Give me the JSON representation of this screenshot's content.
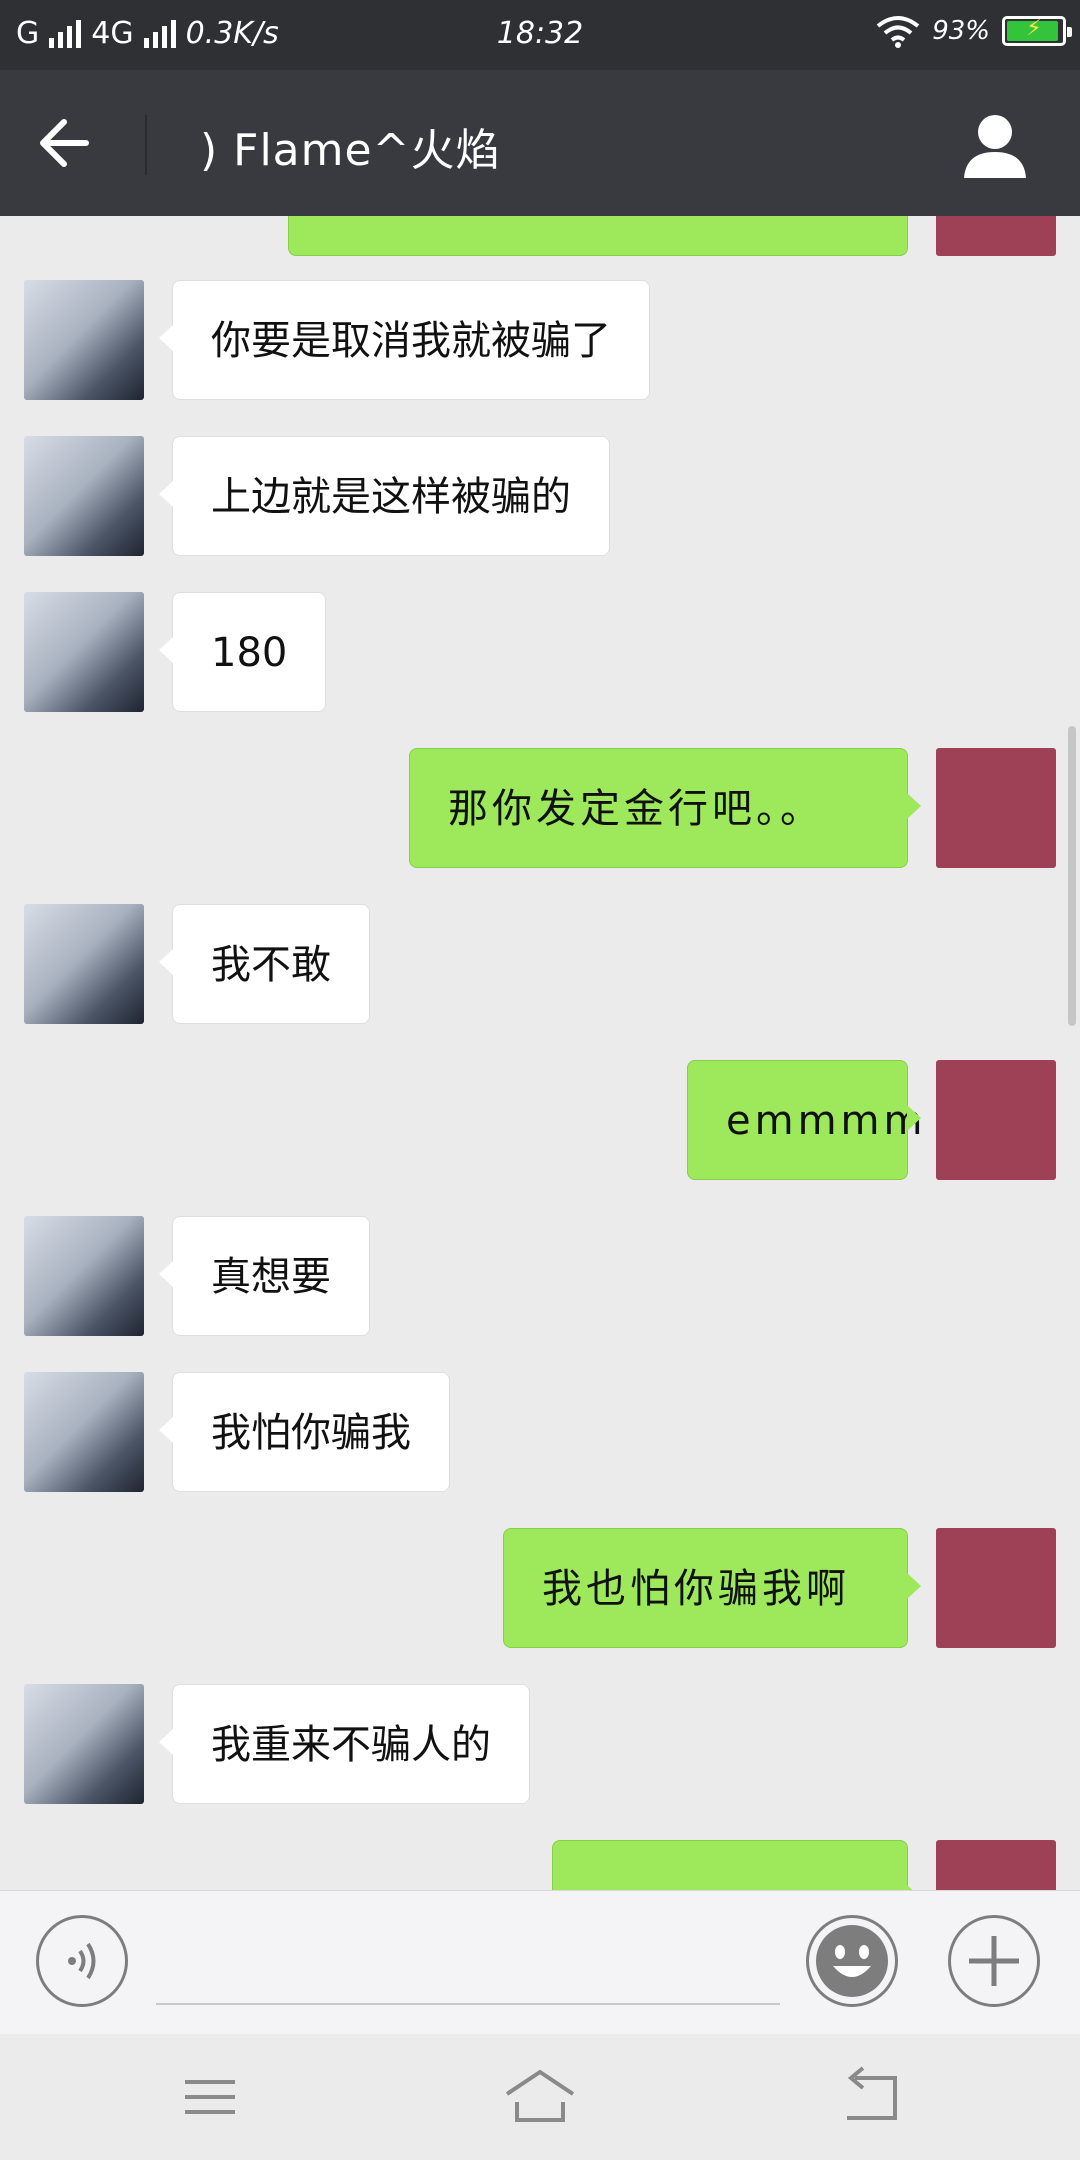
{
  "status_bar": {
    "network_1": "G",
    "network_2": "4G",
    "speed": "0.3K/s",
    "time": "18:32",
    "battery": "93%",
    "battery_level": 0.93
  },
  "header": {
    "title": ") Flame^火焰"
  },
  "messages": [
    {
      "side": "left",
      "text": "你要是取消我就被骗了"
    },
    {
      "side": "left",
      "text": "上边就是这样被骗的"
    },
    {
      "side": "left",
      "text": "180"
    },
    {
      "side": "right",
      "text": "那你发定金行吧。。"
    },
    {
      "side": "left",
      "text": "我不敢"
    },
    {
      "side": "right",
      "text": "emmmm"
    },
    {
      "side": "left",
      "text": "真想要"
    },
    {
      "side": "left",
      "text": "我怕你骗我"
    },
    {
      "side": "right",
      "text": "我也怕你骗我啊"
    },
    {
      "side": "left",
      "text": "我重来不骗人的"
    }
  ],
  "input": {
    "value": "",
    "placeholder": ""
  },
  "colors": {
    "status_bar_bg": "#2f3034",
    "title_bar_bg": "#393a3f",
    "chat_bg": "#ebebeb",
    "bubble_sent": "#9de85b",
    "bubble_received": "#ffffff",
    "battery_fill": "#34c43b"
  }
}
